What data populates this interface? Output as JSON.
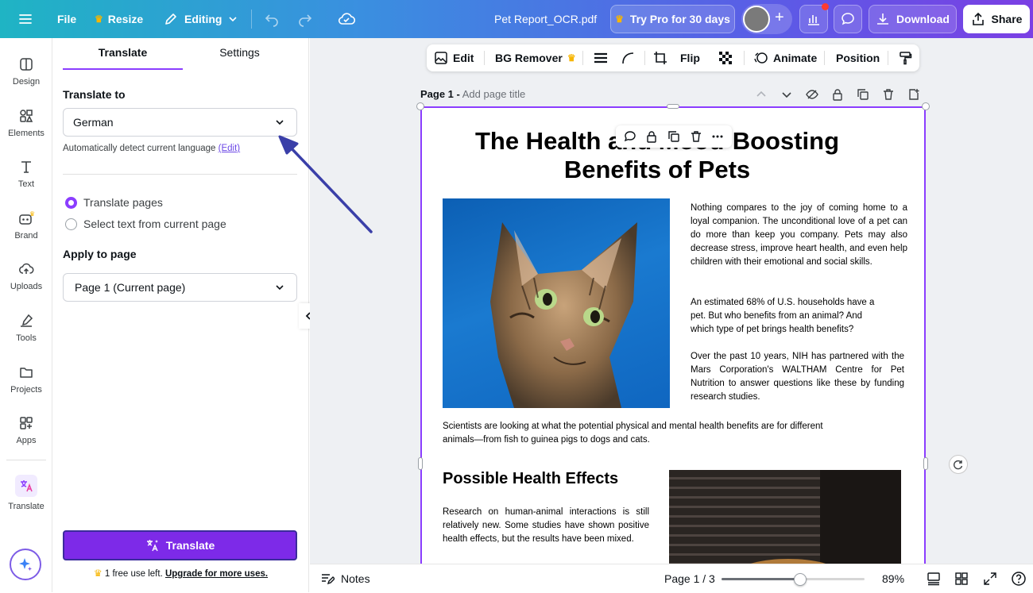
{
  "topbar": {
    "file": "File",
    "resize": "Resize",
    "editing": "Editing",
    "doc_name": "Pet Report_OCR.pdf",
    "try_pro": "Try Pro for 30 days",
    "plus": "+",
    "download": "Download",
    "share": "Share",
    "notification_color": "#ff3b30"
  },
  "rail": {
    "items": [
      {
        "label": "Design",
        "icon": "design-icon"
      },
      {
        "label": "Elements",
        "icon": "elements-icon"
      },
      {
        "label": "Text",
        "icon": "text-icon"
      },
      {
        "label": "Brand",
        "icon": "brand-icon"
      },
      {
        "label": "Uploads",
        "icon": "uploads-icon"
      },
      {
        "label": "Tools",
        "icon": "tools-icon"
      },
      {
        "label": "Projects",
        "icon": "projects-icon"
      },
      {
        "label": "Apps",
        "icon": "apps-icon"
      },
      {
        "label": "Translate",
        "icon": "translate-icon"
      }
    ]
  },
  "panel": {
    "tabs": [
      "Translate",
      "Settings"
    ],
    "translate_to_label": "Translate to",
    "language": "German",
    "auto_detect": "Automatically detect current language",
    "edit_link": "(Edit)",
    "radio_translate_pages": "Translate pages",
    "radio_select_text": "Select text from current page",
    "apply_label": "Apply to page",
    "apply_value": "Page 1 (Current page)",
    "translate_button": "Translate",
    "free_use": "1 free use left.",
    "upgrade": "Upgrade for more uses.",
    "accent": "#8b3dff"
  },
  "toolbar": {
    "edit": "Edit",
    "bg_remover": "BG Remover",
    "flip": "Flip",
    "animate": "Animate",
    "position": "Position"
  },
  "page": {
    "label": "Page 1 -",
    "title_placeholder": "Add page title",
    "doc_title_line1": "The Health and Mood-Boosting",
    "doc_title_line2": "Benefits of Pets",
    "para1": "Nothing compares to the joy of coming home to a loyal companion. The unconditional love of a pet can do more than keep you company. Pets may also decrease stress, improve heart health, and even help children with their emotional and social skills.",
    "para2": "An estimated 68% of U.S. households have a pet. But who benefits from an animal? And which type of pet brings health benefits?",
    "para3": "Over the past 10 years, NIH has partnered with the Mars Corporation's WALTHAM Centre for Pet Nutrition to answer questions like these by funding research studies.",
    "para4": "Scientists are looking at what the potential physical and mental health benefits are for different animals—from fish to guinea pigs to dogs and cats.",
    "heading2": "Possible Health Effects",
    "para5": "Research on human-animal interactions is still relatively new. Some studies have shown positive health effects, but the results have been mixed."
  },
  "bottombar": {
    "notes": "Notes",
    "page_indicator": "Page 1 / 3",
    "zoom": "89%",
    "zoom_level": 0.55
  }
}
